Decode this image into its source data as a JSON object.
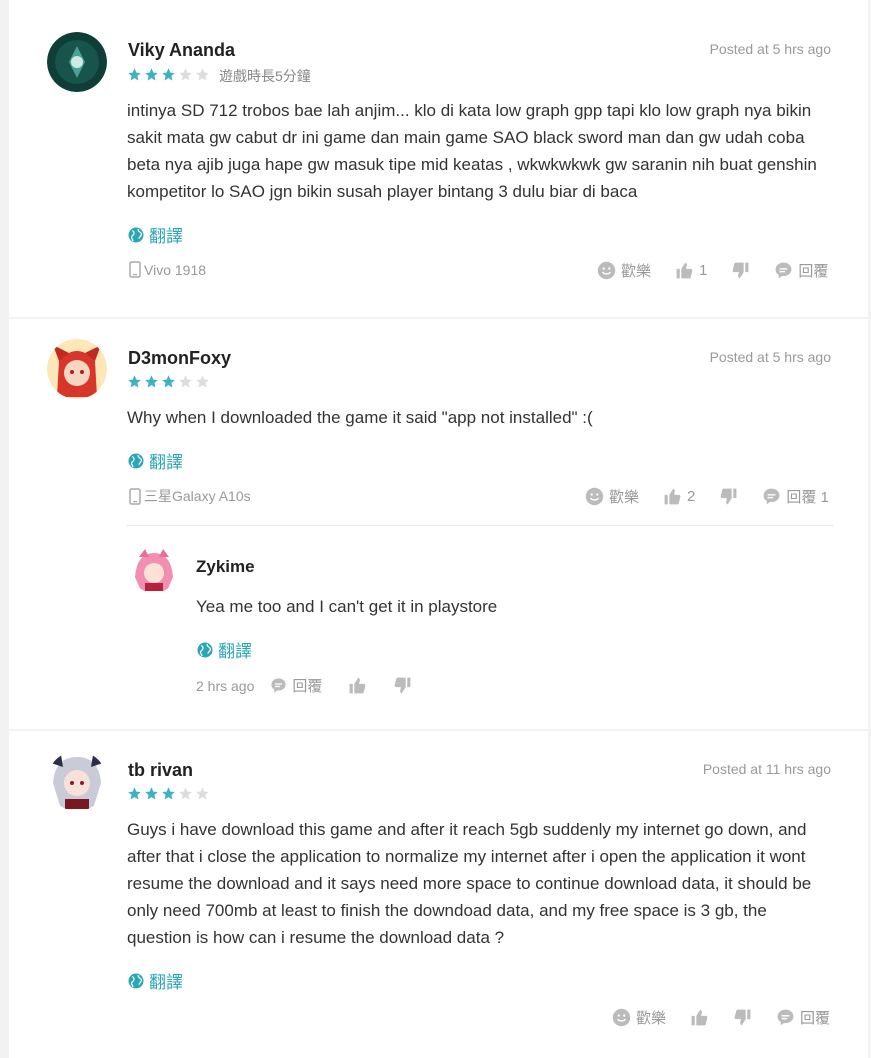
{
  "colors": {
    "accent": "#2aa6b4",
    "star_on": "#3fb2c1",
    "star_off": "#dddddd",
    "muted": "#999999"
  },
  "reviews": [
    {
      "username": "Viky Ananda",
      "posted": "Posted at 5 hrs ago",
      "rating": 3,
      "playtime": "遊戲時長5分鐘",
      "text": "intinya SD 712 trobos bae lah anjim... klo di kata low graph gpp tapi klo low graph nya bikin sakit mata gw cabut dr ini game dan main game SAO black sword man dan gw udah coba beta nya ajib juga hape gw masuk tipe mid keatas , wkwkwkwk gw saranin nih buat genshin kompetitor lo SAO jgn bikin susah player bintang 3 dulu biar di baca",
      "translate": "翻譯",
      "device": "Vivo 1918",
      "fun_label": "歡樂",
      "likes": "1",
      "reply_label": "回覆"
    },
    {
      "username": "D3monFoxy",
      "posted": "Posted at 5 hrs ago",
      "rating": 3,
      "text": "Why when I downloaded the game it said \"app not installed\" :(",
      "translate": "翻譯",
      "device": "三星Galaxy A10s",
      "fun_label": "歡樂",
      "likes": "2",
      "reply_label": "回覆 1",
      "reply": {
        "username": "Zykime",
        "text": "Yea me too and I can't get it in playstore",
        "translate": "翻譯",
        "time": "2 hrs ago",
        "reply_label": "回覆"
      }
    },
    {
      "username": "tb rivan",
      "posted": "Posted at 11 hrs ago",
      "rating": 3,
      "text": "Guys i have download this game and after it reach 5gb suddenly my internet go down, and after that i close the application to normalize my internet after i open the application it wont resume the download and it says need more space to continue download data, it should be only need 700mb at least to finish the downdoad data, and my free space is 3 gb, the question is how can i resume the download data ?",
      "translate": "翻譯",
      "fun_label": "歡樂",
      "reply_label": "回覆"
    }
  ]
}
